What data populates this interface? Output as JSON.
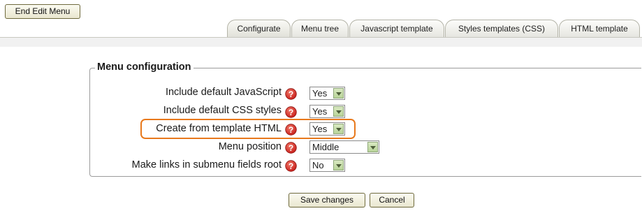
{
  "toolbar": {
    "end_edit_label": "End Edit Menu"
  },
  "tabs": [
    {
      "label": "Configurate",
      "active": true
    },
    {
      "label": "Menu tree"
    },
    {
      "label": "Javascript template"
    },
    {
      "label": "Styles templates (CSS)"
    },
    {
      "label": "HTML template"
    }
  ],
  "section": {
    "legend": "Menu configuration"
  },
  "fields": [
    {
      "label": "Include default JavaScript",
      "value": "Yes"
    },
    {
      "label": "Include default CSS styles",
      "value": "Yes"
    },
    {
      "label": "Create from template HTML",
      "value": "Yes",
      "highlighted": true
    },
    {
      "label": "Menu position",
      "value": "Middle"
    },
    {
      "label": "Make links in submenu fields root",
      "value": "No"
    }
  ],
  "actions": {
    "save_label": "Save changes",
    "cancel_label": "Cancel"
  },
  "colors": {
    "highlight": "#e8791c",
    "help_icon": "#c8201c",
    "select_arrow": "#b9d499"
  }
}
